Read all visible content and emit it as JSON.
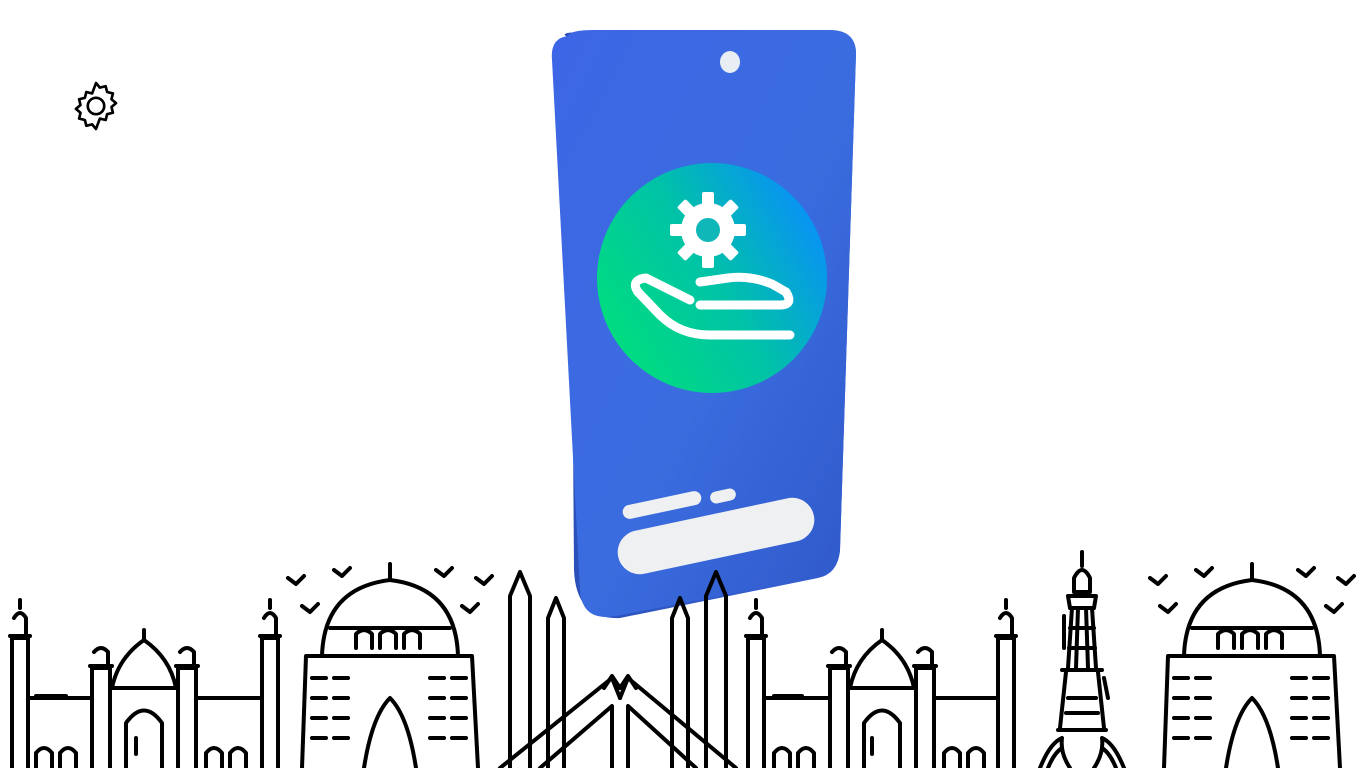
{
  "settings": {
    "icon": "gear-icon"
  },
  "hero": {
    "icon": "hand-gear-icon",
    "device": "phone",
    "colors": {
      "phone_body": "#3b6fe0",
      "circle_start": "#00e07a",
      "circle_end": "#0a8cff",
      "pill": "#eef0f2"
    }
  },
  "skyline": {
    "landmarks": [
      "badshahi-mosque",
      "mazar-e-quaid",
      "faisal-mosque",
      "badshahi-mosque",
      "minar-e-pakistan",
      "mazar-e-quaid"
    ],
    "stroke": "#000000"
  }
}
